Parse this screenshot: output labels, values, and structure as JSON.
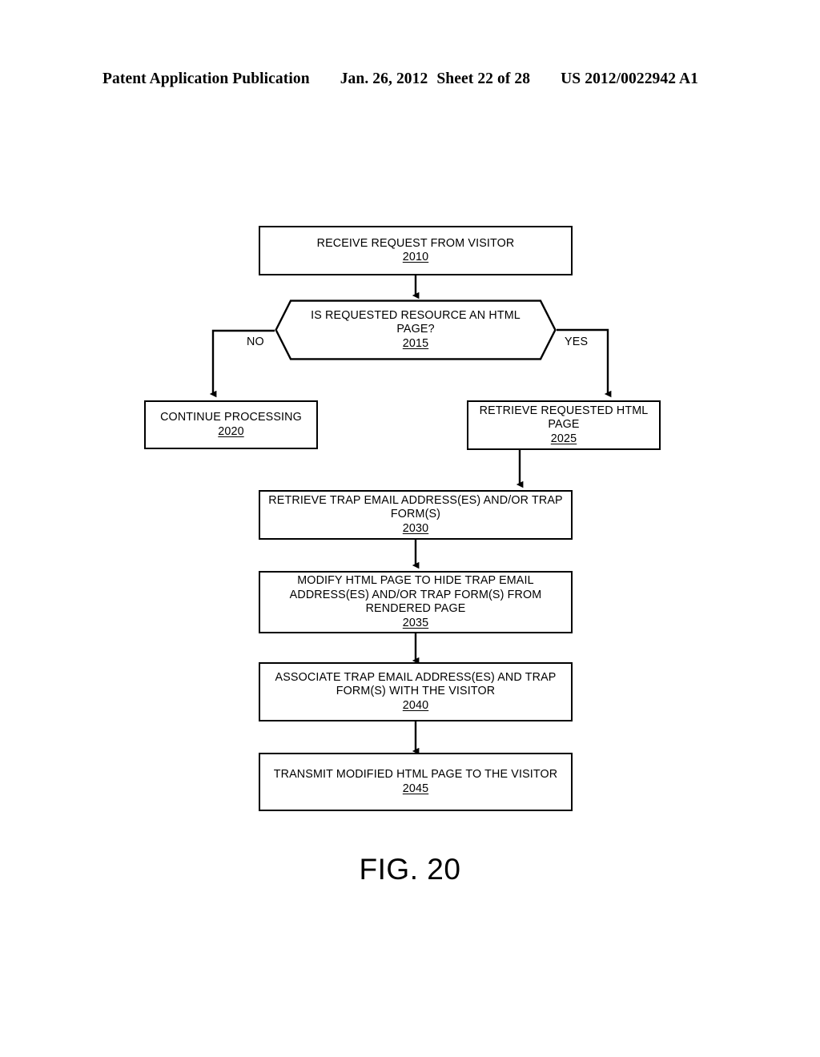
{
  "header": {
    "publication": "Patent Application Publication",
    "date": "Jan. 26, 2012",
    "sheet": "Sheet 22 of 28",
    "document_number": "US 2012/0022942 A1"
  },
  "figure": {
    "caption": "FIG. 20",
    "nodes": [
      {
        "id": "2010",
        "shape": "process",
        "text": "RECEIVE REQUEST FROM VISITOR",
        "ref": "2010"
      },
      {
        "id": "2015",
        "shape": "decision",
        "text": "IS REQUESTED RESOURCE AN HTML\nPAGE?",
        "ref": "2015"
      },
      {
        "id": "2020",
        "shape": "process",
        "text": "CONTINUE PROCESSING",
        "ref": "2020"
      },
      {
        "id": "2025",
        "shape": "process",
        "text": "RETRIEVE REQUESTED HTML\nPAGE",
        "ref": "2025"
      },
      {
        "id": "2030",
        "shape": "process",
        "text": "RETRIEVE TRAP EMAIL ADDRESS(ES) AND/OR TRAP\nFORM(S)",
        "ref": "2030"
      },
      {
        "id": "2035",
        "shape": "process",
        "text": "MODIFY HTML PAGE TO HIDE TRAP EMAIL\nADDRESS(ES) AND/OR TRAP FORM(S) FROM\nRENDERED PAGE",
        "ref": "2035"
      },
      {
        "id": "2040",
        "shape": "process",
        "text": "ASSOCIATE TRAP EMAIL ADDRESS(ES) AND TRAP\nFORM(S) WITH THE VISITOR",
        "ref": "2040"
      },
      {
        "id": "2045",
        "shape": "process",
        "text": "TRANSMIT MODIFIED HTML PAGE TO THE VISITOR",
        "ref": "2045"
      }
    ],
    "branch_labels": {
      "no": "NO",
      "yes": "YES"
    }
  },
  "colors": {
    "stroke": "#000000",
    "background": "#ffffff",
    "text": "#000000"
  }
}
